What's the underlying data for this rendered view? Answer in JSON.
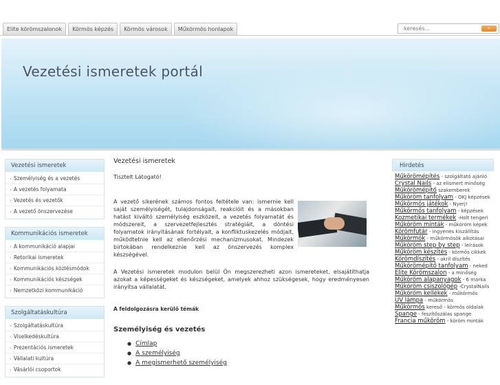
{
  "nav": {
    "tabs": [
      "Elite körömszalonok",
      "Körmös képzés",
      "Körmös városok",
      "Műkörmös honlapok"
    ]
  },
  "search": {
    "placeholder": "keresés..."
  },
  "banner": {
    "title": "Vezetési ismeretek portál"
  },
  "left": [
    {
      "title": "Vezetési ismeretek",
      "items": [
        "Személyiség és a vezetés",
        "A vezetés folyamata",
        "Vezetés és vezetők",
        "A vezető önszervezése"
      ]
    },
    {
      "title": "Kommunikációs ismeretek",
      "items": [
        "A kommunikáció alapjai",
        "Retorikai ismeretek",
        "Kommunikációs közlésmódok",
        "Kommunikációs készségek",
        "Nemzetközi kommunikáció"
      ]
    },
    {
      "title": "Szolgáltatáskultúra",
      "items": [
        "Szolgáltatáskultúra",
        "Viselkedéskultúra",
        "Prezentációs ismeretek",
        "Vállalati kultúra",
        "Vásárlói csoportok"
      ]
    }
  ],
  "main": {
    "title": "Vezetési ismeretek",
    "greeting": "Tisztelt Látogató!",
    "para1": "A vezető sikerének számos fontos feltétele van: ismernie kell saját személyiségét, tulajdonságait, reakcióit és a másokban hatást kiváltó személyiség eszközeit, a vezetés folyamatát és módszereit, a szervezetfejlesztés stratégiáit, a döntési folyamatok irányításának fortélyait, a konfliktuskezelés módjait, működtetnie kell az ellenőrzési mechanizmusokat. Mindezek birtokában rendelkeznie kell az önszervezés komplex készségével.",
    "para2": "A Vezetési ismeretek modulon belül Ön megszerezheti azon ismereteket, elsajátíthatja azokat a képességeket és készségeket, amelyek ahhoz szükségesek, hogy eredményesen irányítsa vállalatát.",
    "featured": "A feldolgozásra kerülő témák",
    "subtitle": "Személyiség és vezetés",
    "links": [
      "Címlap",
      "A személyiség",
      "A megismerhető személyiség"
    ]
  },
  "ads": {
    "title": "Hirdetés",
    "items": [
      {
        "link": "Műkörömépítés",
        "desc": " - szolgáltató ajánló"
      },
      {
        "link": "Crystal Nails",
        "desc": " - az elismert minőség"
      },
      {
        "link": "Műkörömépítő",
        "desc": " szakemberek"
      },
      {
        "link": "Műköröm tanfolyam",
        "desc": " - OKJ képzések"
      },
      {
        "link": "Műkörmös játékok",
        "desc": " - Nyerj!"
      },
      {
        "link": "Műkörmös tanfolyam",
        "desc": " - képzések"
      },
      {
        "link": "Kozmetikai termékek",
        "desc": " -Holt tengeri"
      },
      {
        "link": "Műköröm minták",
        "desc": " - műköröm képek"
      },
      {
        "link": "Körömfutár",
        "desc": " - ingyenes kiszállítás"
      },
      {
        "link": "Műkörmök",
        "desc": " - műkörmösök alkotásai"
      },
      {
        "link": "Műköröm step by step",
        "desc": " - leírások"
      },
      {
        "link": "Műköröm készítés",
        "desc": " - körmös cikkek"
      },
      {
        "link": "Körömdíszítés",
        "desc": " - akril díszítés"
      },
      {
        "link": "Műkörömépítő tanfolyam",
        "desc": " - neked"
      },
      {
        "link": "Elite Körömszalon",
        "desc": " - a minőség"
      },
      {
        "link": "Műköröm alapanyagok",
        "desc": " - 6 márka"
      },
      {
        "link": "Műköröm csiszológép",
        "desc": " -CrystalNails"
      },
      {
        "link": "Műköröm kellékek",
        "desc": " - műkörmös"
      },
      {
        "link": "UV lámpa",
        "desc": " - műkörmös"
      },
      {
        "link": "Műkörmös",
        "desc": " kereső - körmös oldalak"
      },
      {
        "link": "Spange",
        "desc": " - feszítőszálas spange"
      },
      {
        "link": "Francia műköröm",
        "desc": " - köröm minták"
      }
    ]
  }
}
